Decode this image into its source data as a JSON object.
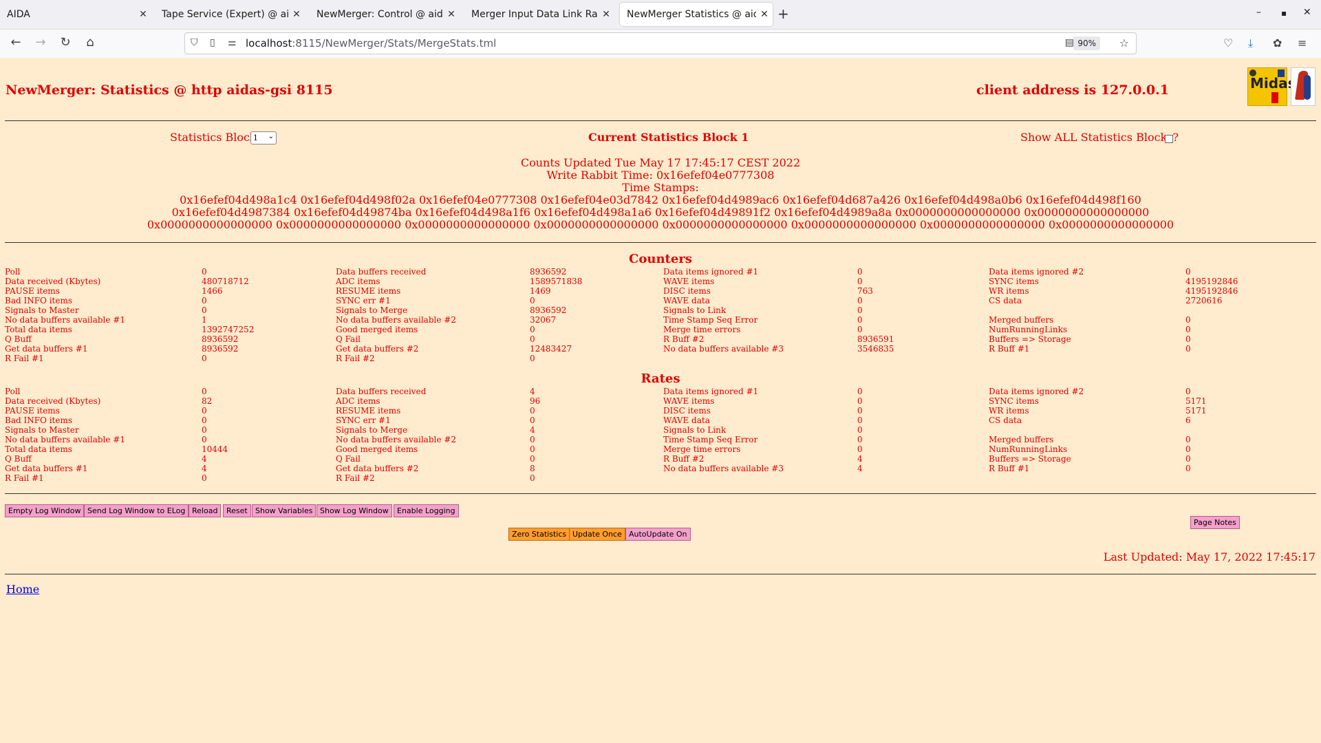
{
  "browser": {
    "tabs": [
      {
        "title": "AIDA",
        "active": false
      },
      {
        "title": "Tape Service (Expert) @ aidas",
        "active": false
      },
      {
        "title": "NewMerger: Control @ aidas",
        "active": false
      },
      {
        "title": "Merger Input Data Link Rates",
        "active": false
      },
      {
        "title": "NewMerger Statistics @ aidas",
        "active": true
      }
    ],
    "url_host": "localhost",
    "url_path": ":8115/NewMerger/Stats/MergeStats.tml",
    "zoom": "90%"
  },
  "page": {
    "title": "NewMerger: Statistics @ http aidas-gsi 8115",
    "client": "client address is 127.0.0.1",
    "logo_text": "Midas",
    "stats_block_label": "Statistics Block",
    "stats_block_value": "1",
    "current_block": "Current Statistics Block 1",
    "show_all_label": "Show ALL Statistics Blocks?",
    "counts_updated": "Counts Updated Tue May 17 17:45:17 CEST 2022",
    "write_rabbit": "Write Rabbit Time: 0x16efef04e0777308",
    "timestamps_label": "Time Stamps:",
    "timestamps": [
      "0x16efef04d498a1c4 0x16efef04d498f02a 0x16efef04e0777308 0x16efef04e03d7842 0x16efef04d4989ac6 0x16efef04d687a426 0x16efef04d498a0b6 0x16efef04d498f160",
      "0x16efef04d4987384 0x16efef04d49874ba 0x16efef04d498a1f6 0x16efef04d498a1a6 0x16efef04d49891f2 0x16efef04d4989a8a 0x0000000000000000 0x0000000000000000",
      "0x0000000000000000 0x0000000000000000 0x0000000000000000 0x0000000000000000 0x0000000000000000 0x0000000000000000 0x0000000000000000 0x0000000000000000"
    ],
    "counters_title": "Counters",
    "rates_title": "Rates",
    "labels": [
      [
        "Poll",
        "Data buffers received",
        "Data items ignored #1",
        "Data items ignored #2"
      ],
      [
        "Data received (Kbytes)",
        "ADC items",
        "WAVE items",
        "SYNC items"
      ],
      [
        "PAUSE items",
        "RESUME items",
        "DISC items",
        "WR items"
      ],
      [
        "Bad INFO items",
        "SYNC err #1",
        "WAVE data",
        "CS data"
      ],
      [
        "Signals to Master",
        "Signals to Merge",
        "Signals to Link",
        ""
      ],
      [
        "No data buffers available #1",
        "No data buffers available #2",
        "Time Stamp Seq Error",
        "Merged buffers"
      ],
      [
        "Total data items",
        "Good merged items",
        "Merge time errors",
        "NumRunningLinks"
      ],
      [
        "Q Buff",
        "Q Fail",
        "R Buff #2",
        "Buffers => Storage"
      ],
      [
        "Get data buffers #1",
        "Get data buffers #2",
        "No data buffers available #3",
        "R Buff #1"
      ],
      [
        "R Fail #1",
        "R Fail #2",
        "",
        ""
      ]
    ],
    "counters": [
      [
        "0",
        "8936592",
        "0",
        "0"
      ],
      [
        "480718712",
        "1589571838",
        "0",
        "4195192846"
      ],
      [
        "1466",
        "1469",
        "763",
        "4195192846"
      ],
      [
        "0",
        "0",
        "0",
        "2720616"
      ],
      [
        "0",
        "8936592",
        "0",
        ""
      ],
      [
        "1",
        "32067",
        "0",
        "0"
      ],
      [
        "1392747252",
        "0",
        "0",
        "0"
      ],
      [
        "8936592",
        "0",
        "8936591",
        "0"
      ],
      [
        "8936592",
        "12483427",
        "3546835",
        "0"
      ],
      [
        "0",
        "0",
        "",
        ""
      ]
    ],
    "rates": [
      [
        "0",
        "4",
        "0",
        "0"
      ],
      [
        "82",
        "96",
        "0",
        "5171"
      ],
      [
        "0",
        "0",
        "0",
        "5171"
      ],
      [
        "0",
        "0",
        "0",
        "6"
      ],
      [
        "0",
        "4",
        "0",
        ""
      ],
      [
        "0",
        "0",
        "0",
        "0"
      ],
      [
        "10444",
        "0",
        "0",
        "0"
      ],
      [
        "4",
        "0",
        "4",
        "0"
      ],
      [
        "4",
        "8",
        "4",
        "0"
      ],
      [
        "0",
        "0",
        "",
        ""
      ]
    ],
    "buttons": {
      "empty_log": "Empty Log Window",
      "send_log": "Send Log Window to ELog",
      "reload": "Reload",
      "reset": "Reset",
      "show_vars": "Show Variables",
      "show_log": "Show Log Window",
      "enable_logging": "Enable Logging",
      "page_notes": "Page Notes",
      "zero_stats": "Zero Statistics",
      "update_once": "Update Once",
      "autoupdate": "AutoUpdate On"
    },
    "last_updated": "Last Updated: May 17, 2022 17:45:17",
    "home": "Home"
  },
  "colors": {
    "page_bg": "#ffebcd",
    "text": "#e00000",
    "pink_button": "#f4a0cc",
    "orange_button": "#ff9d2e"
  }
}
